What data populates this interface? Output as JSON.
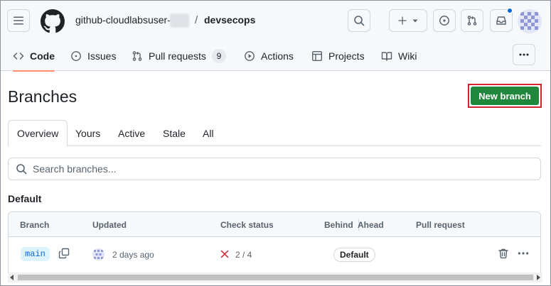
{
  "header": {
    "owner": "github-cloudlabsuser-",
    "separator": "/",
    "repo": "devsecops",
    "icons": [
      "menu-icon",
      "github-logo",
      "search-icon",
      "plus-icon",
      "chevron-down-icon",
      "copilot-icon",
      "pull-request-icon",
      "inbox-icon",
      "avatar"
    ]
  },
  "repo_nav": {
    "tabs": [
      {
        "label": "Code",
        "icon": "code-icon",
        "active": true
      },
      {
        "label": "Issues",
        "icon": "issue-icon"
      },
      {
        "label": "Pull requests",
        "icon": "pull-request-icon",
        "count": "9"
      },
      {
        "label": "Actions",
        "icon": "play-icon"
      },
      {
        "label": "Projects",
        "icon": "table-icon"
      },
      {
        "label": "Wiki",
        "icon": "book-icon"
      }
    ]
  },
  "page": {
    "title": "Branches",
    "new_branch_label": "New branch"
  },
  "filter_tabs": [
    "Overview",
    "Yours",
    "Active",
    "Stale",
    "All"
  ],
  "search": {
    "placeholder": "Search branches..."
  },
  "section": {
    "title": "Default"
  },
  "table": {
    "columns": [
      "Branch",
      "Updated",
      "Check status",
      "Behind",
      "Ahead",
      "Pull request"
    ],
    "rows": [
      {
        "branch": "main",
        "updated": "2 days ago",
        "check_status": "2 / 4",
        "badge": "Default"
      }
    ]
  },
  "colors": {
    "primary_button": "#1f883d",
    "highlight_border": "#d1242f",
    "active_tab_underline": "#fd8c73",
    "branch_pill_bg": "#ddf4ff",
    "branch_pill_text": "#0969da",
    "check_fail": "#d1242f"
  }
}
